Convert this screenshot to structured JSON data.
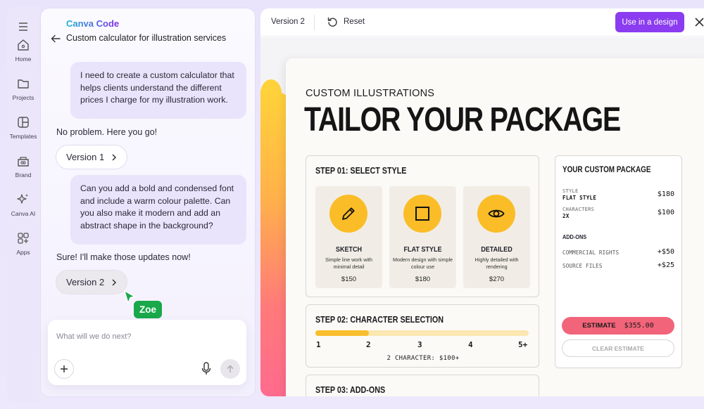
{
  "sidebar": {
    "items": [
      {
        "label": "Home",
        "icon": "home-icon"
      },
      {
        "label": "Projects",
        "icon": "folder-icon"
      },
      {
        "label": "Templates",
        "icon": "templates-icon"
      },
      {
        "label": "Brand",
        "icon": "brand-icon"
      },
      {
        "label": "Canva AI",
        "icon": "sparkle-icon"
      },
      {
        "label": "Apps",
        "icon": "apps-icon"
      }
    ]
  },
  "chat": {
    "brand": "Canva Code",
    "title": "Custom calculator for illustration services",
    "messages": [
      {
        "role": "user",
        "text": "I need to create a custom calculator that helps clients understand the different prices I charge for my illustration work."
      },
      {
        "role": "assistant",
        "text": "No problem. Here you go!",
        "version": "Version 1"
      },
      {
        "role": "user",
        "text": "Can you add a bold and condensed font and include a warm colour palette. Can you also make it modern and add an abstract shape in the background?"
      },
      {
        "role": "assistant",
        "text": "Sure! I'll make those updates now!",
        "version": "Version 2"
      }
    ],
    "cursor_label": "Zoe",
    "input_placeholder": "What will we do next?"
  },
  "preview": {
    "version_label": "Version 2",
    "reset_label": "Reset",
    "use_button": "Use in a design",
    "kicker": "CUSTOM ILLUSTRATIONS",
    "headline": "TAILOR YOUR PACKAGE",
    "step1": {
      "title": "STEP 01: SELECT STYLE",
      "options": [
        {
          "name": "SKETCH",
          "desc": "Simple line work with minimal detail",
          "price": "$150",
          "icon": "pencil-icon"
        },
        {
          "name": "FLAT STYLE",
          "desc": "Modern design with simple colour use",
          "price": "$180",
          "icon": "square-icon"
        },
        {
          "name": "DETAILED",
          "desc": "Highly detailed with rendering",
          "price": "$270",
          "icon": "eye-icon"
        }
      ]
    },
    "step2": {
      "title": "STEP 02: CHARACTER SELECTION",
      "ticks": [
        "1",
        "2",
        "3",
        "4",
        "5+"
      ],
      "selected_fraction": 0.25,
      "summary": "2 CHARACTER: $100+"
    },
    "step3": {
      "title": "STEP 03: ADD-ONS"
    },
    "summary": {
      "title": "YOUR CUSTOM PACKAGE",
      "style_label": "STYLE",
      "style_value": "FLAT STYLE",
      "style_price": "$180",
      "characters_label": "CHARACTERS",
      "characters_value": "2X",
      "characters_price": "$100",
      "addons_title": "ADD-ONS",
      "addons": [
        {
          "label": "COMMERCIAL RIGHTS",
          "price": "+$50"
        },
        {
          "label": "SOURCE FILES",
          "price": "+$25"
        }
      ],
      "estimate_label": "ESTIMATE",
      "estimate_value": "$355.00",
      "clear_label": "CLEAR ESTIMATE"
    }
  },
  "colors": {
    "accent_purple": "#8b3cf0",
    "yellow": "#fbbd27",
    "coral": "#f2647a",
    "cursor_green": "#19a84a"
  }
}
